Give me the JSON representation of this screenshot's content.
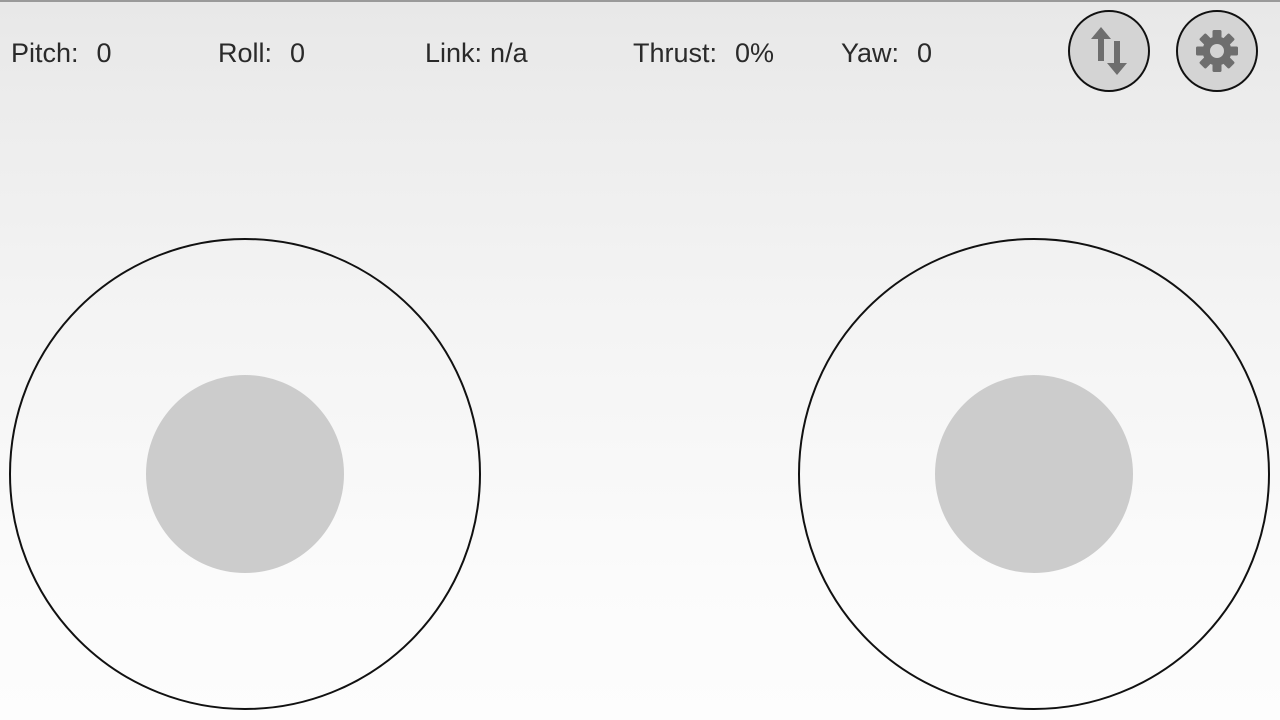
{
  "telemetry": {
    "pitch": {
      "label": "Pitch:",
      "value": "0"
    },
    "roll": {
      "label": "Roll:",
      "value": "0"
    },
    "link": {
      "label": "Link:",
      "value": "n/a"
    },
    "thrust": {
      "label": "Thrust:",
      "value": "0%"
    },
    "yaw": {
      "label": "Yaw:",
      "value": "0"
    }
  },
  "toolbar": {
    "connect_icon": "swap-vertical-icon",
    "settings_icon": "gear-icon"
  },
  "joysticks": {
    "left": {
      "knob_position": {
        "x": 0,
        "y": 0
      }
    },
    "right": {
      "knob_position": {
        "x": 0,
        "y": 0
      }
    }
  },
  "colors": {
    "knob": "#cccccc",
    "button_bg": "#d4d4d4",
    "icon": "#6e6e6e",
    "outline": "#111111"
  }
}
